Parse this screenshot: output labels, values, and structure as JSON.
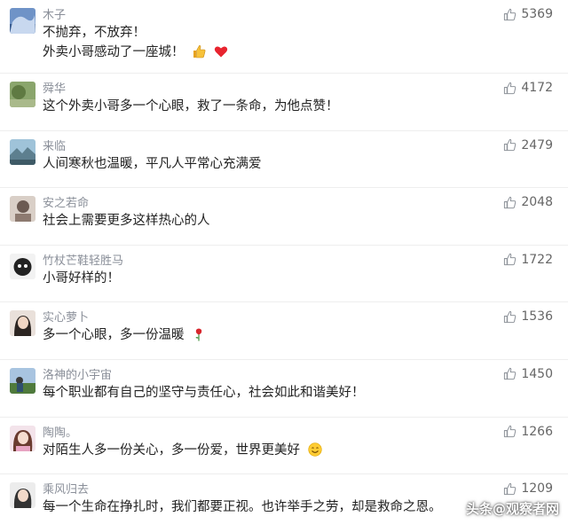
{
  "comments": [
    {
      "name": "木子",
      "lines": [
        "不抛弃，不放弃！",
        "外卖小哥感动了一座城！"
      ],
      "likes": "5369",
      "emojis": [
        "thumbs-up-emoji",
        "red-heart-emoji"
      ]
    },
    {
      "name": "舜华",
      "lines": [
        "这个外卖小哥多一个心眼，救了一条命，为他点赞！"
      ],
      "likes": "4172"
    },
    {
      "name": "来临",
      "lines": [
        "人间寒秋也温暖，平凡人平常心充满爱"
      ],
      "likes": "2479"
    },
    {
      "name": "安之若命",
      "lines": [
        "社会上需要更多这样热心的人"
      ],
      "likes": "2048"
    },
    {
      "name": "竹杖芒鞋轻胜马",
      "lines": [
        "小哥好样的！"
      ],
      "likes": "1722"
    },
    {
      "name": "实心萝卜",
      "lines": [
        "多一个心眼，多一份温暖"
      ],
      "likes": "1536",
      "emojis": [
        "rose-emoji"
      ]
    },
    {
      "name": "洛神的小宇宙",
      "lines": [
        "每个职业都有自己的坚守与责任心，社会如此和谐美好！"
      ],
      "likes": "1450"
    },
    {
      "name": "陶陶。",
      "lines": [
        "对陌生人多一份关心，多一份爱，世界更美好"
      ],
      "likes": "1266",
      "emojis": [
        "smiling-face-emoji"
      ]
    },
    {
      "name": "乘风归去",
      "lines": [
        "每一个生命在挣扎时，我们都要正视。也许举手之劳，却是救命之恩。"
      ],
      "likes": "1209"
    }
  ],
  "watermark": "头条@观察者网",
  "colors": {
    "name": "#8a8f99",
    "text": "#222222",
    "like": "#666666"
  }
}
